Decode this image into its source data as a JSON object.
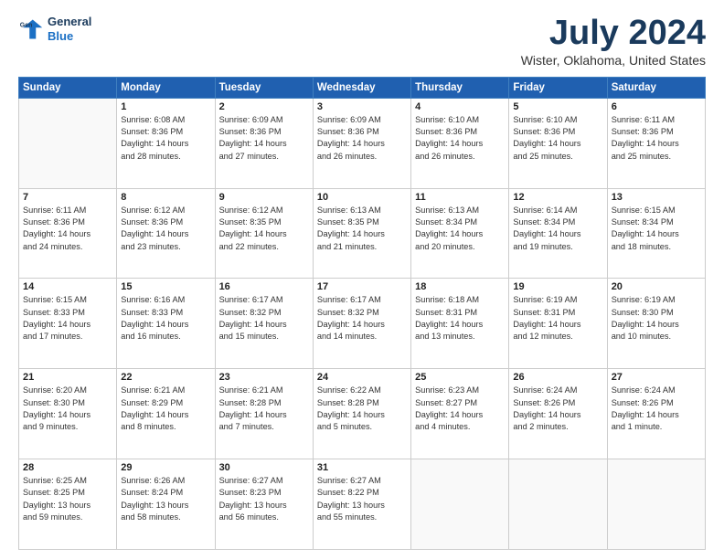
{
  "logo": {
    "line1": "General",
    "line2": "Blue"
  },
  "title": "July 2024",
  "location": "Wister, Oklahoma, United States",
  "headers": [
    "Sunday",
    "Monday",
    "Tuesday",
    "Wednesday",
    "Thursday",
    "Friday",
    "Saturday"
  ],
  "weeks": [
    [
      {
        "num": "",
        "lines": []
      },
      {
        "num": "1",
        "lines": [
          "Sunrise: 6:08 AM",
          "Sunset: 8:36 PM",
          "Daylight: 14 hours",
          "and 28 minutes."
        ]
      },
      {
        "num": "2",
        "lines": [
          "Sunrise: 6:09 AM",
          "Sunset: 8:36 PM",
          "Daylight: 14 hours",
          "and 27 minutes."
        ]
      },
      {
        "num": "3",
        "lines": [
          "Sunrise: 6:09 AM",
          "Sunset: 8:36 PM",
          "Daylight: 14 hours",
          "and 26 minutes."
        ]
      },
      {
        "num": "4",
        "lines": [
          "Sunrise: 6:10 AM",
          "Sunset: 8:36 PM",
          "Daylight: 14 hours",
          "and 26 minutes."
        ]
      },
      {
        "num": "5",
        "lines": [
          "Sunrise: 6:10 AM",
          "Sunset: 8:36 PM",
          "Daylight: 14 hours",
          "and 25 minutes."
        ]
      },
      {
        "num": "6",
        "lines": [
          "Sunrise: 6:11 AM",
          "Sunset: 8:36 PM",
          "Daylight: 14 hours",
          "and 25 minutes."
        ]
      }
    ],
    [
      {
        "num": "7",
        "lines": [
          "Sunrise: 6:11 AM",
          "Sunset: 8:36 PM",
          "Daylight: 14 hours",
          "and 24 minutes."
        ]
      },
      {
        "num": "8",
        "lines": [
          "Sunrise: 6:12 AM",
          "Sunset: 8:36 PM",
          "Daylight: 14 hours",
          "and 23 minutes."
        ]
      },
      {
        "num": "9",
        "lines": [
          "Sunrise: 6:12 AM",
          "Sunset: 8:35 PM",
          "Daylight: 14 hours",
          "and 22 minutes."
        ]
      },
      {
        "num": "10",
        "lines": [
          "Sunrise: 6:13 AM",
          "Sunset: 8:35 PM",
          "Daylight: 14 hours",
          "and 21 minutes."
        ]
      },
      {
        "num": "11",
        "lines": [
          "Sunrise: 6:13 AM",
          "Sunset: 8:34 PM",
          "Daylight: 14 hours",
          "and 20 minutes."
        ]
      },
      {
        "num": "12",
        "lines": [
          "Sunrise: 6:14 AM",
          "Sunset: 8:34 PM",
          "Daylight: 14 hours",
          "and 19 minutes."
        ]
      },
      {
        "num": "13",
        "lines": [
          "Sunrise: 6:15 AM",
          "Sunset: 8:34 PM",
          "Daylight: 14 hours",
          "and 18 minutes."
        ]
      }
    ],
    [
      {
        "num": "14",
        "lines": [
          "Sunrise: 6:15 AM",
          "Sunset: 8:33 PM",
          "Daylight: 14 hours",
          "and 17 minutes."
        ]
      },
      {
        "num": "15",
        "lines": [
          "Sunrise: 6:16 AM",
          "Sunset: 8:33 PM",
          "Daylight: 14 hours",
          "and 16 minutes."
        ]
      },
      {
        "num": "16",
        "lines": [
          "Sunrise: 6:17 AM",
          "Sunset: 8:32 PM",
          "Daylight: 14 hours",
          "and 15 minutes."
        ]
      },
      {
        "num": "17",
        "lines": [
          "Sunrise: 6:17 AM",
          "Sunset: 8:32 PM",
          "Daylight: 14 hours",
          "and 14 minutes."
        ]
      },
      {
        "num": "18",
        "lines": [
          "Sunrise: 6:18 AM",
          "Sunset: 8:31 PM",
          "Daylight: 14 hours",
          "and 13 minutes."
        ]
      },
      {
        "num": "19",
        "lines": [
          "Sunrise: 6:19 AM",
          "Sunset: 8:31 PM",
          "Daylight: 14 hours",
          "and 12 minutes."
        ]
      },
      {
        "num": "20",
        "lines": [
          "Sunrise: 6:19 AM",
          "Sunset: 8:30 PM",
          "Daylight: 14 hours",
          "and 10 minutes."
        ]
      }
    ],
    [
      {
        "num": "21",
        "lines": [
          "Sunrise: 6:20 AM",
          "Sunset: 8:30 PM",
          "Daylight: 14 hours",
          "and 9 minutes."
        ]
      },
      {
        "num": "22",
        "lines": [
          "Sunrise: 6:21 AM",
          "Sunset: 8:29 PM",
          "Daylight: 14 hours",
          "and 8 minutes."
        ]
      },
      {
        "num": "23",
        "lines": [
          "Sunrise: 6:21 AM",
          "Sunset: 8:28 PM",
          "Daylight: 14 hours",
          "and 7 minutes."
        ]
      },
      {
        "num": "24",
        "lines": [
          "Sunrise: 6:22 AM",
          "Sunset: 8:28 PM",
          "Daylight: 14 hours",
          "and 5 minutes."
        ]
      },
      {
        "num": "25",
        "lines": [
          "Sunrise: 6:23 AM",
          "Sunset: 8:27 PM",
          "Daylight: 14 hours",
          "and 4 minutes."
        ]
      },
      {
        "num": "26",
        "lines": [
          "Sunrise: 6:24 AM",
          "Sunset: 8:26 PM",
          "Daylight: 14 hours",
          "and 2 minutes."
        ]
      },
      {
        "num": "27",
        "lines": [
          "Sunrise: 6:24 AM",
          "Sunset: 8:26 PM",
          "Daylight: 14 hours",
          "and 1 minute."
        ]
      }
    ],
    [
      {
        "num": "28",
        "lines": [
          "Sunrise: 6:25 AM",
          "Sunset: 8:25 PM",
          "Daylight: 13 hours",
          "and 59 minutes."
        ]
      },
      {
        "num": "29",
        "lines": [
          "Sunrise: 6:26 AM",
          "Sunset: 8:24 PM",
          "Daylight: 13 hours",
          "and 58 minutes."
        ]
      },
      {
        "num": "30",
        "lines": [
          "Sunrise: 6:27 AM",
          "Sunset: 8:23 PM",
          "Daylight: 13 hours",
          "and 56 minutes."
        ]
      },
      {
        "num": "31",
        "lines": [
          "Sunrise: 6:27 AM",
          "Sunset: 8:22 PM",
          "Daylight: 13 hours",
          "and 55 minutes."
        ]
      },
      {
        "num": "",
        "lines": []
      },
      {
        "num": "",
        "lines": []
      },
      {
        "num": "",
        "lines": []
      }
    ]
  ]
}
